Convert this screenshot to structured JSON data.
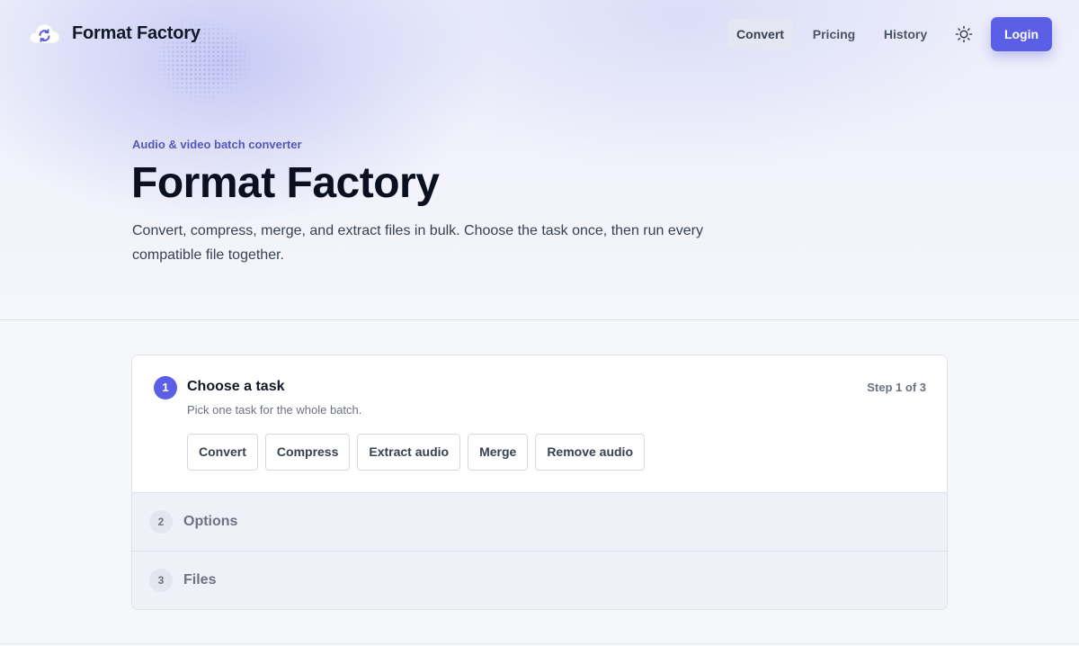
{
  "header": {
    "brand": "Format Factory",
    "nav": [
      {
        "label": "Convert",
        "active": true
      },
      {
        "label": "Pricing",
        "active": false
      },
      {
        "label": "History",
        "active": false
      }
    ],
    "theme_toggle_icon": "sun-icon",
    "login_label": "Login",
    "accent_color": "#5b5fe6"
  },
  "hero": {
    "eyebrow": "Audio & video batch converter",
    "title": "Format Factory",
    "description": "Convert, compress, merge, and extract files in bulk. Choose the task once, then run every compatible file together."
  },
  "wizard": {
    "steps": [
      {
        "number": "1",
        "title": "Choose a task",
        "subtitle": "Pick one task for the whole batch.",
        "counter": "Step 1 of 3",
        "tasks": [
          "Convert",
          "Compress",
          "Extract audio",
          "Merge",
          "Remove audio"
        ]
      },
      {
        "number": "2",
        "title": "Options"
      },
      {
        "number": "3",
        "title": "Files"
      }
    ]
  }
}
